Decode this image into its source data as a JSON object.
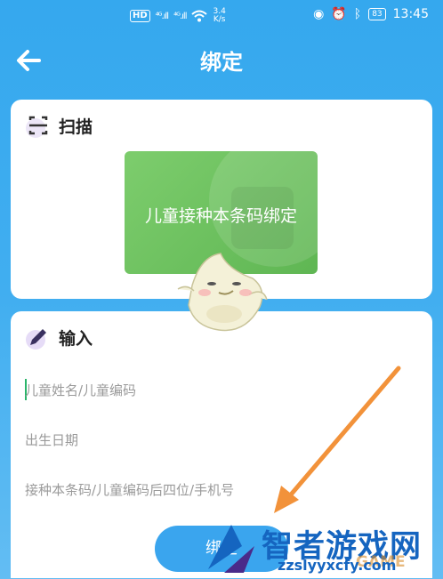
{
  "status": {
    "network": "HD",
    "signal1": "⁴ᴳ.ıll",
    "signal2": "⁴ᴳ.ıll",
    "speed_value": "3.4",
    "speed_unit": "K/s",
    "battery": "83",
    "time": "13:45"
  },
  "header": {
    "title": "绑定"
  },
  "scan": {
    "title": "扫描",
    "tile_label": "儿童接种本条码绑定"
  },
  "input": {
    "title": "输入",
    "field1_placeholder": "儿童姓名/儿童编码",
    "field2_placeholder": "出生日期",
    "field3_placeholder": "接种本条码/儿童编码后四位/手机号"
  },
  "actions": {
    "bind_label": "绑定"
  },
  "watermark": {
    "main": "智者游戏网",
    "sub": "zzslyyxcfy.com",
    "shadow": "GAME"
  },
  "colors": {
    "primary": "#35a8ee",
    "tile": "#6cc25f",
    "arrow": "#f2923a"
  }
}
